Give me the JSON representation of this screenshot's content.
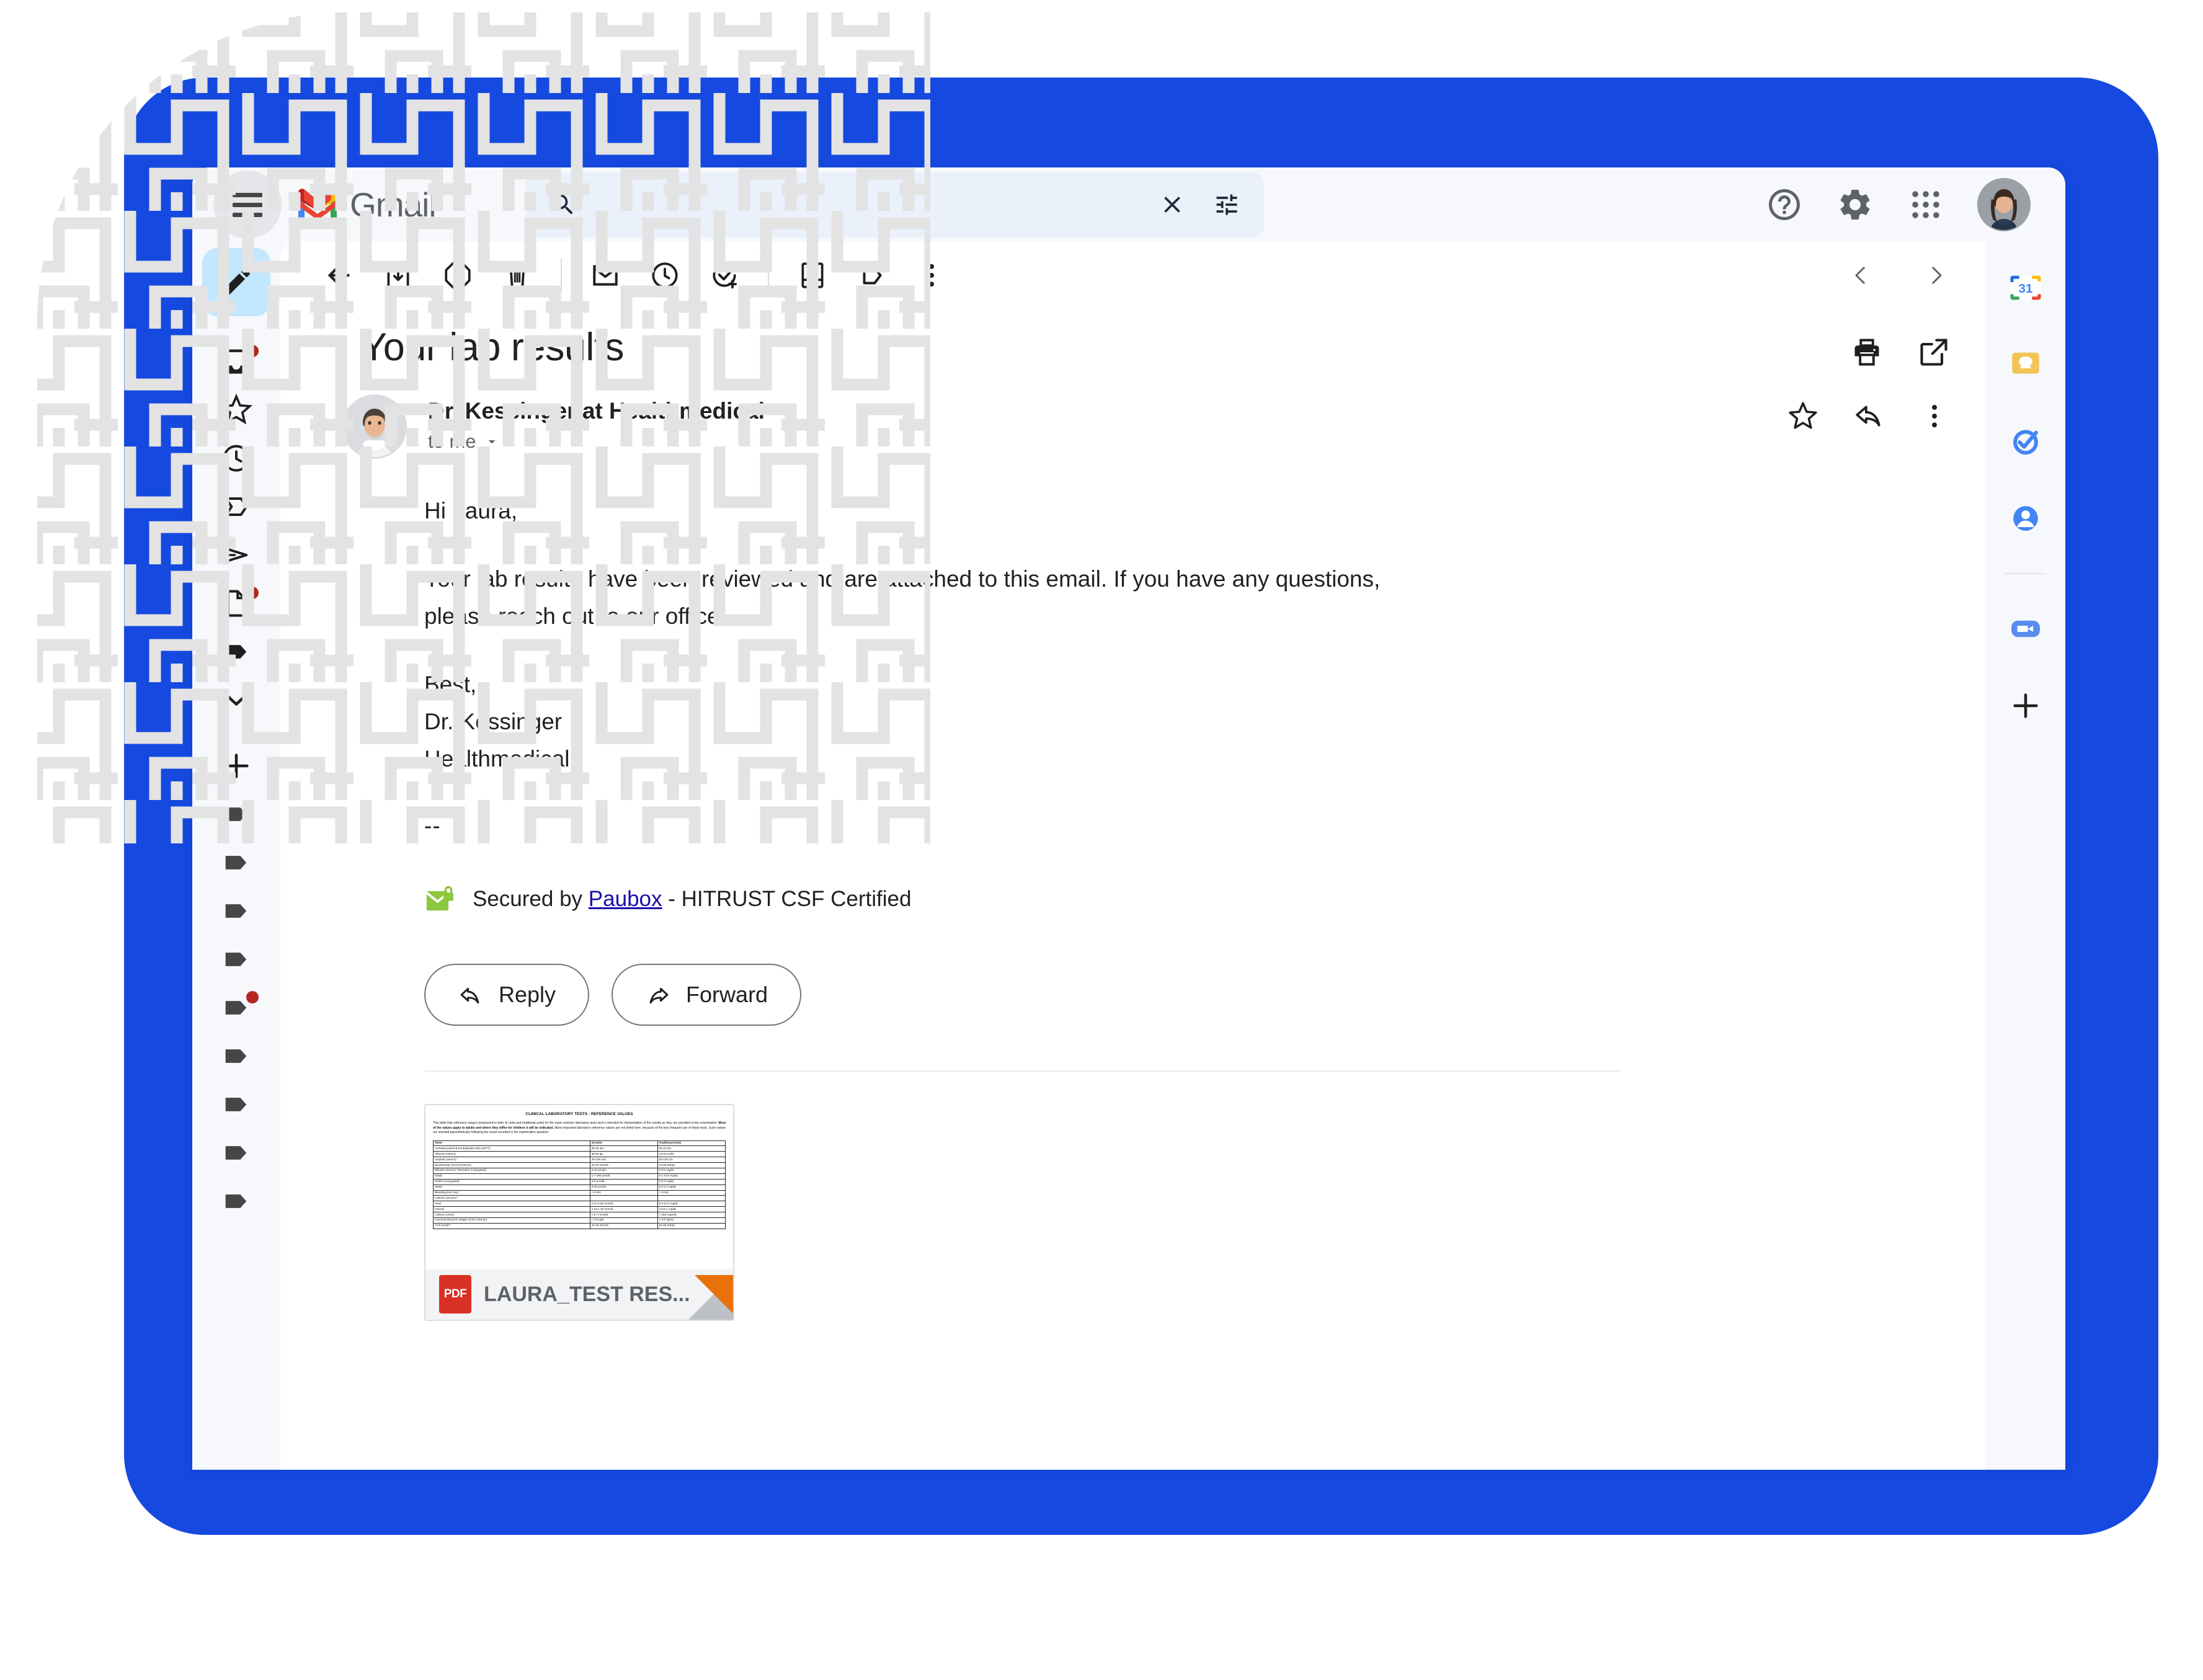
{
  "app": {
    "name": "Gmail",
    "hamburger_label": "Main menu"
  },
  "search": {
    "value": "",
    "placeholder": "",
    "icon": "search-icon",
    "clear_icon": "close-icon",
    "options_icon": "tune-icon"
  },
  "header_actions": [
    {
      "name": "support-icon",
      "label": "Support"
    },
    {
      "name": "settings-icon",
      "label": "Settings"
    },
    {
      "name": "apps-grid-icon",
      "label": "Google apps"
    },
    {
      "name": "avatar",
      "label": "Google Account"
    }
  ],
  "left_rail": {
    "compose": {
      "label": "Compose",
      "icon": "pencil-icon"
    },
    "items": [
      {
        "name": "inbox",
        "icon": "inbox-icon",
        "badge": true
      },
      {
        "name": "starred",
        "icon": "star-icon",
        "badge": false
      },
      {
        "name": "snoozed",
        "icon": "clock-icon",
        "badge": false
      },
      {
        "name": "important",
        "icon": "label-important-icon",
        "badge": false
      },
      {
        "name": "sent",
        "icon": "send-icon",
        "badge": false
      },
      {
        "name": "drafts",
        "icon": "draft-icon",
        "badge": true
      },
      {
        "name": "label-1",
        "icon": "label-icon",
        "badge": false
      },
      {
        "name": "more",
        "icon": "chevron-down-icon",
        "badge": false
      },
      {
        "name": "new-label",
        "icon": "plus-icon",
        "badge": false
      },
      {
        "name": "label-2",
        "icon": "label-icon",
        "badge": false
      },
      {
        "name": "label-3",
        "icon": "label-icon",
        "badge": false
      },
      {
        "name": "label-4",
        "icon": "label-icon",
        "badge": false
      },
      {
        "name": "label-5",
        "icon": "label-icon",
        "badge": false
      },
      {
        "name": "label-6",
        "icon": "label-icon",
        "badge": true
      },
      {
        "name": "label-7",
        "icon": "label-icon",
        "badge": false
      },
      {
        "name": "label-8",
        "icon": "label-icon",
        "badge": false
      },
      {
        "name": "label-9",
        "icon": "label-icon",
        "badge": false
      },
      {
        "name": "label-10",
        "icon": "label-icon",
        "badge": false
      }
    ]
  },
  "toolbar": {
    "items": [
      {
        "name": "back-button",
        "icon": "arrow-back-icon",
        "label": "Back to Inbox"
      },
      {
        "name": "archive-button",
        "icon": "archive-icon",
        "label": "Archive"
      },
      {
        "name": "report-spam-button",
        "icon": "report-spam-icon",
        "label": "Report spam"
      },
      {
        "name": "delete-button",
        "icon": "trash-icon",
        "label": "Delete"
      },
      {
        "name": "mark-unread-button",
        "icon": "mail-icon",
        "label": "Mark as unread"
      },
      {
        "name": "snooze-button",
        "icon": "clock-icon",
        "label": "Snooze"
      },
      {
        "name": "add-to-tasks-button",
        "icon": "add-task-icon",
        "label": "Add to tasks"
      },
      {
        "name": "move-to-button",
        "icon": "move-to-inbox-icon",
        "label": "Move to"
      },
      {
        "name": "labels-button",
        "icon": "label-icon",
        "label": "Labels"
      },
      {
        "name": "more-button",
        "icon": "more-vert-icon",
        "label": "More"
      }
    ],
    "prev_label": "Newer",
    "next_label": "Older"
  },
  "email": {
    "subject": "Your lab results",
    "sender": "Dr. Kessinger at Healthmedical",
    "recipient": "to me",
    "print_label": "Print all",
    "open_new_window_label": "Open in new window",
    "star_label": "Star",
    "reply_label": "Reply",
    "more_label": "More",
    "body": {
      "greeting": "Hi Laura,",
      "paragraph": "Your lab results have been reviewed and are attached to this email. If you have any questions, please reach out to our office.",
      "signoff": "Best,",
      "signature_name": "Dr. Kessinger",
      "signature_org": "Healthmedical",
      "separator": "--"
    },
    "paubox": {
      "prefix": "Secured by",
      "link": "Paubox",
      "suffix": "- HITRUST CSF Certified",
      "icon": "secure-mail-icon"
    },
    "actions": {
      "reply": "Reply",
      "forward": "Forward"
    },
    "attachment": {
      "name": "LAURA_TEST RES...",
      "type": "PDF",
      "preview": {
        "title": "CLINICAL LABORATORY TESTS - REFERENCE VALUES",
        "intro_before_bold": "This table lists reference ranges (expressed in both SI units and traditional units) for the most common laboratory tests and is intended for interpretation of the results as they are provided in the examination.",
        "intro_bold": "Most of the values apply to adults and where they differ for children it will be indicated.",
        "intro_after_bold": "Many important laboratory reference values are not listed here, because of the less frequent use of these tests. Such values are inserted parenthetically following the result recorded in the examination question.",
        "headers": [
          "Tests",
          "SI Units",
          "Traditional Units"
        ],
        "rows": [
          [
            "Activated partial thromboplastin time (aPTT)",
            "25-40 sec",
            "25-40 sec"
          ],
          [
            "Albumin (serum)",
            "35-50 g/L",
            "3.5-5.0 g/dL"
          ],
          [
            "Amylase (serum)",
            "25-125 IU/L",
            "25-125 U/L"
          ],
          [
            "Bicarbonate (HCO3) (serum)",
            "22-29 mmol/L",
            "22-29 mEq/L"
          ],
          [
            "Bilirubin (serum)*  Neonates  (conjugated)",
            "0-10 µmol/L",
            "0-0.6 mg/dL"
          ],
          [
            "(total)",
            "1.7-180 µmol/L",
            "0.1-10.5 mg/dL"
          ],
          [
            "Adults    (conjugated)",
            "0-5 µmol/L",
            "0-0.3 mg/dL"
          ],
          [
            "(total)",
            "0-35 µmol/L",
            "0.2-1.3 mg/dL"
          ],
          [
            "Bleeding time (Ivy)",
            "< 9 min",
            "< 9 min"
          ],
          [
            "Calcium (serum)**",
            "",
            ""
          ],
          [
            "Total",
            "2.10-2.60 mmol/L",
            "8.4-10.4 mg/dL"
          ],
          [
            "Ionized",
            "1.15-1.35 mmol/L",
            "4.6-5.1 mg/dL"
          ],
          [
            "Calcium (urine)",
            "< 6.7 mmol/d",
            "< 250 mg/24h"
          ],
          [
            "Carcinoembryonic antigen (CEA) (serum)",
            "< 3.0 µg/L",
            "< 3.0 ng/mL"
          ],
          [
            "CO2 (total)**",
            "22-29 mmol/L",
            "22-29 mEq/L"
          ]
        ]
      }
    }
  },
  "right_rail": {
    "items": [
      {
        "name": "google-calendar-icon",
        "label": "Calendar",
        "badge_text": "31"
      },
      {
        "name": "google-keep-icon",
        "label": "Keep"
      },
      {
        "name": "google-tasks-icon",
        "label": "Tasks"
      },
      {
        "name": "google-contacts-icon",
        "label": "Contacts"
      },
      {
        "name": "zoom-icon",
        "label": "Zoom"
      },
      {
        "name": "plus-icon",
        "label": "Get add-ons"
      }
    ]
  },
  "colors": {
    "brand_blue": "#1549e0",
    "gmail_red": "#ea4335",
    "accent_blue": "#1a73e8",
    "compose_bg": "#c2e7ff",
    "paubox_green": "#8dc63f",
    "pdf_red": "#d93025",
    "badge_red": "#b3261e"
  }
}
